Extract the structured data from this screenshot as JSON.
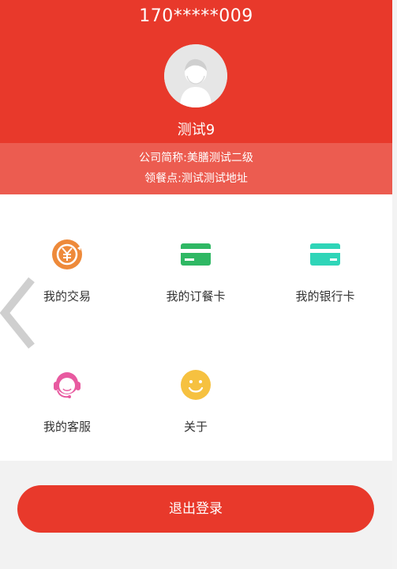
{
  "profile": {
    "phone": "170*****009",
    "name": "测试9",
    "company": "公司简称:美膳测试二级",
    "pickup_point": "领餐点:测试测试地址"
  },
  "menu": {
    "items": [
      {
        "label": "我的交易",
        "icon": "yuan-coin-icon",
        "color": "#ee8a3a"
      },
      {
        "label": "我的订餐卡",
        "icon": "meal-card-icon",
        "color": "#2fb864"
      },
      {
        "label": "我的银行卡",
        "icon": "bank-card-icon",
        "color": "#2fd5b8"
      },
      {
        "label": "我的客服",
        "icon": "customer-service-icon",
        "color": "#e85aa0"
      },
      {
        "label": "关于",
        "icon": "smiley-icon",
        "color": "#f6c140"
      }
    ]
  },
  "logout_label": "退出登录",
  "colors": {
    "primary": "#e8392b",
    "band": "#ec5c50",
    "background": "#f2f2f2"
  }
}
